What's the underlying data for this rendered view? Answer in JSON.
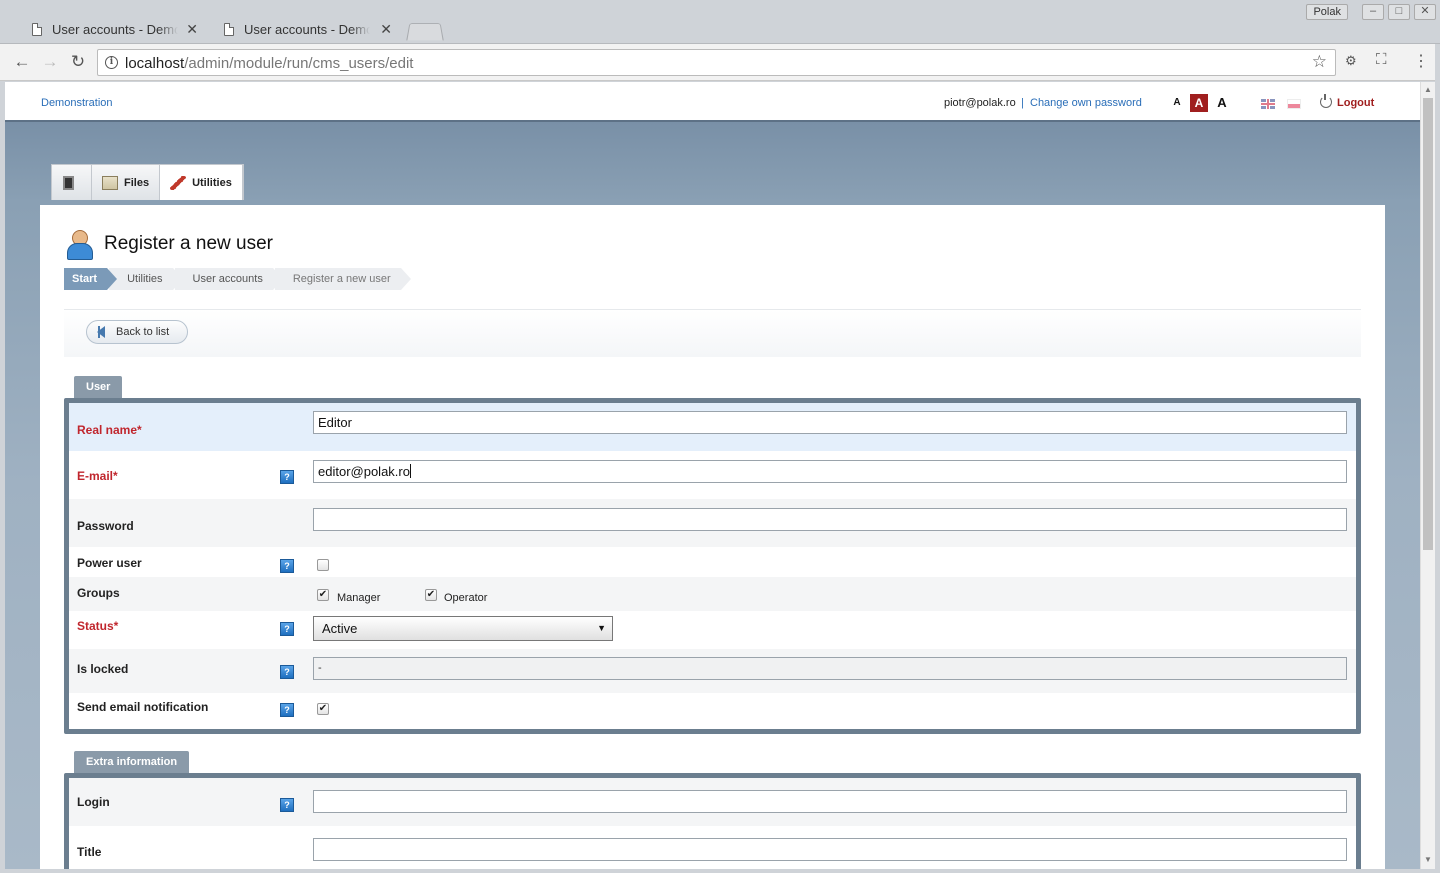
{
  "browser": {
    "tabs": [
      {
        "title": "User accounts - Demonstration",
        "active": true
      },
      {
        "title": "User accounts - Demonstration",
        "active": false
      }
    ],
    "profile": "Polak",
    "url_host": "localhost",
    "url_path": "/admin/module/run/cms_users/edit",
    "icons": {
      "back": "←",
      "forward": "→",
      "reload": "↻",
      "star": "☆",
      "close": "✕",
      "menu": "⋮"
    }
  },
  "topbar": {
    "site_link": "Demonstration",
    "user_email": "piotr@polak.ro",
    "separator": "|",
    "change_password": "Change own password",
    "font_sizes": [
      "A",
      "A",
      "A"
    ],
    "logout": "Logout"
  },
  "module_tabs": [
    {
      "label": ""
    },
    {
      "label": "Files"
    },
    {
      "label": "Utilities"
    }
  ],
  "page": {
    "title": "Register a new user",
    "breadcrumbs": [
      "Start",
      "Utilities",
      "User accounts",
      "Register a new user"
    ],
    "back_button": "Back to list"
  },
  "user_fieldset": {
    "legend": "User",
    "real_name": {
      "label": "Real name*",
      "value": "Editor"
    },
    "email": {
      "label": "E-mail*",
      "value": "editor@polak.ro"
    },
    "password": {
      "label": "Password",
      "value": ""
    },
    "power_user": {
      "label": "Power user",
      "checked": false
    },
    "groups": {
      "label": "Groups",
      "options": [
        {
          "label": "Manager",
          "checked": true
        },
        {
          "label": "Operator",
          "checked": true
        }
      ]
    },
    "status": {
      "label": "Status*",
      "value": "Active"
    },
    "is_locked": {
      "label": "Is locked",
      "value": "-"
    },
    "send_email": {
      "label": "Send email notification",
      "checked": true
    },
    "help_glyph": "?"
  },
  "extra_fieldset": {
    "legend": "Extra information",
    "login": {
      "label": "Login",
      "value": ""
    },
    "title": {
      "label": "Title",
      "value": ""
    }
  },
  "colors": {
    "required_label": "#c0262d",
    "link": "#2a6eb8",
    "logout": "#a01f1f",
    "fieldset_border": "#6b7e8f",
    "breadcrumb_active": "#7b9ab8"
  }
}
